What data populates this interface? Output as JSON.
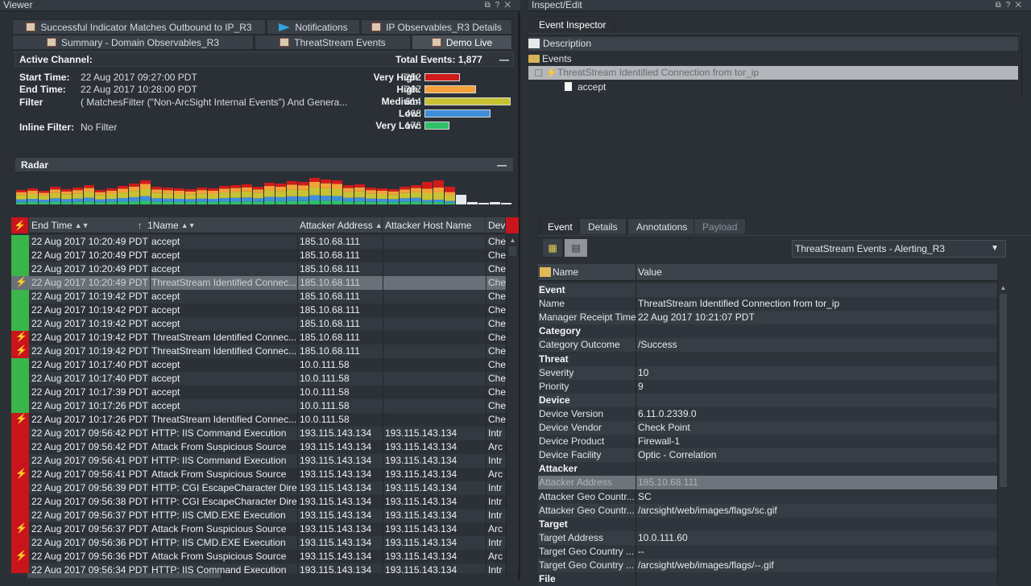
{
  "viewer": {
    "title": "Viewer",
    "tabs_row1": [
      "Successful Indicator Matches Outbound to IP_R3",
      "Notifications",
      "IP Observables_R3 Details"
    ],
    "tabs_row2": [
      "Summary - Domain Observables_R3",
      "ThreatStream Events",
      "Demo Live"
    ],
    "active_channel_label": "Active Channel:",
    "total_events_label": "Total Events: 1,877",
    "start_time_label": "Start Time:",
    "start_time": "22 Aug 2017 09:27:00 PDT",
    "end_time_label": "End Time:",
    "end_time": "22 Aug 2017 10:28:00 PDT",
    "filter_label": "Filter",
    "filter_value": "( MatchesFilter (\"Non-ArcSight Internal Events\") And Genera...",
    "inline_filter_label": "Inline Filter:",
    "inline_filter_value": "No Filter",
    "severity": [
      {
        "label": "Very High:",
        "count": "252",
        "value": 252,
        "color": "#d11a1a"
      },
      {
        "label": "High:",
        "count": "367",
        "value": 367,
        "color": "#f3a23a"
      },
      {
        "label": "Medium:",
        "count": "614",
        "value": 614,
        "color": "#c8c233"
      },
      {
        "label": "Low:",
        "count": "468",
        "value": 468,
        "color": "#3f8fd9"
      },
      {
        "label": "Very Low:",
        "count": "176",
        "value": 176,
        "color": "#2fbf6a"
      }
    ],
    "radar_label": "Radar",
    "minimize": "—",
    "columns": [
      "End Time",
      "1",
      "Name",
      "Attacker Address",
      "Attacker Host Name",
      "Dev"
    ],
    "rows": [
      {
        "ind": "green",
        "time": "22 Aug 2017 10:20:49 PDT",
        "name": "accept",
        "addr": "185.10.68.111",
        "host": "",
        "dev": "Che"
      },
      {
        "ind": "green",
        "time": "22 Aug 2017 10:20:49 PDT",
        "name": "accept",
        "addr": "185.10.68.111",
        "host": "",
        "dev": "Che"
      },
      {
        "ind": "green",
        "time": "22 Aug 2017 10:20:49 PDT",
        "name": "accept",
        "addr": "185.10.68.111",
        "host": "",
        "dev": "Che"
      },
      {
        "ind": "bolt",
        "time": "22 Aug 2017 10:20:49 PDT",
        "name": "ThreatStream Identified Connec...",
        "addr": "185.10.68.111",
        "host": "",
        "dev": "Che",
        "sel": true
      },
      {
        "ind": "green",
        "time": "22 Aug 2017 10:19:42 PDT",
        "name": "accept",
        "addr": "185.10.68.111",
        "host": "",
        "dev": "Che"
      },
      {
        "ind": "green",
        "time": "22 Aug 2017 10:19:42 PDT",
        "name": "accept",
        "addr": "185.10.68.111",
        "host": "",
        "dev": "Che"
      },
      {
        "ind": "green",
        "time": "22 Aug 2017 10:19:42 PDT",
        "name": "accept",
        "addr": "185.10.68.111",
        "host": "",
        "dev": "Che"
      },
      {
        "ind": "bolt",
        "time": "22 Aug 2017 10:19:42 PDT",
        "name": "ThreatStream Identified Connec...",
        "addr": "185.10.68.111",
        "host": "",
        "dev": "Che"
      },
      {
        "ind": "bolt",
        "time": "22 Aug 2017 10:19:42 PDT",
        "name": "ThreatStream Identified Connec...",
        "addr": "185.10.68.111",
        "host": "",
        "dev": "Che"
      },
      {
        "ind": "green",
        "time": "22 Aug 2017 10:17:40 PDT",
        "name": "accept",
        "addr": "10.0.111.58",
        "host": "",
        "dev": "Che"
      },
      {
        "ind": "green",
        "time": "22 Aug 2017 10:17:40 PDT",
        "name": "accept",
        "addr": "10.0.111.58",
        "host": "",
        "dev": "Che"
      },
      {
        "ind": "green",
        "time": "22 Aug 2017 10:17:39 PDT",
        "name": "accept",
        "addr": "10.0.111.58",
        "host": "",
        "dev": "Che"
      },
      {
        "ind": "green",
        "time": "22 Aug 2017 10:17:26 PDT",
        "name": "accept",
        "addr": "10.0.111.58",
        "host": "",
        "dev": "Che"
      },
      {
        "ind": "bolt",
        "time": "22 Aug 2017 10:17:26 PDT",
        "name": "ThreatStream Identified Connec...",
        "addr": "10.0.111.58",
        "host": "",
        "dev": "Che"
      },
      {
        "ind": "red",
        "time": "22 Aug 2017 09:56:42 PDT",
        "name": "HTTP: IIS Command Execution",
        "addr": "193.115.143.134",
        "host": "193.115.143.134",
        "dev": "Intr"
      },
      {
        "ind": "red",
        "time": "22 Aug 2017 09:56:42 PDT",
        "name": "Attack From Suspicious Source",
        "addr": "193.115.143.134",
        "host": "193.115.143.134",
        "dev": "Arc"
      },
      {
        "ind": "red",
        "time": "22 Aug 2017 09:56:41 PDT",
        "name": "HTTP: IIS Command Execution",
        "addr": "193.115.143.134",
        "host": "193.115.143.134",
        "dev": "Intr"
      },
      {
        "ind": "bolt",
        "time": "22 Aug 2017 09:56:41 PDT",
        "name": "Attack From Suspicious Source",
        "addr": "193.115.143.134",
        "host": "193.115.143.134",
        "dev": "Arc"
      },
      {
        "ind": "red",
        "time": "22 Aug 2017 09:56:39 PDT",
        "name": "HTTP: CGI EscapeCharacter Dire...",
        "addr": "193.115.143.134",
        "host": "193.115.143.134",
        "dev": "Intr"
      },
      {
        "ind": "red",
        "time": "22 Aug 2017 09:56:38 PDT",
        "name": "HTTP: CGI EscapeCharacter Dire...",
        "addr": "193.115.143.134",
        "host": "193.115.143.134",
        "dev": "Intr"
      },
      {
        "ind": "red",
        "time": "22 Aug 2017 09:56:37 PDT",
        "name": "HTTP: IIS CMD.EXE Execution",
        "addr": "193.115.143.134",
        "host": "193.115.143.134",
        "dev": "Intr"
      },
      {
        "ind": "bolt",
        "time": "22 Aug 2017 09:56:37 PDT",
        "name": "Attack From Suspicious Source",
        "addr": "193.115.143.134",
        "host": "193.115.143.134",
        "dev": "Arc"
      },
      {
        "ind": "red",
        "time": "22 Aug 2017 09:56:36 PDT",
        "name": "HTTP: IIS CMD.EXE Execution",
        "addr": "193.115.143.134",
        "host": "193.115.143.134",
        "dev": "Intr"
      },
      {
        "ind": "bolt",
        "time": "22 Aug 2017 09:56:36 PDT",
        "name": "Attack From Suspicious Source",
        "addr": "193.115.143.134",
        "host": "193.115.143.134",
        "dev": "Arc"
      },
      {
        "ind": "red",
        "time": "22 Aug 2017 09:56:34 PDT",
        "name": "HTTP: IIS Command Execution",
        "addr": "193.115.143.134",
        "host": "193.115.143.134",
        "dev": "Intr"
      }
    ]
  },
  "inspect": {
    "title": "Inspect/Edit",
    "tab": "Event Inspector",
    "tree_description": "Description",
    "tree_events": "Events",
    "tree_selected": "ThreatStream Identified Connection from tor_ip",
    "tree_child": "accept",
    "lower_tabs": [
      "Event",
      "Details",
      "Annotations",
      "Payload"
    ],
    "dropdown_value": "ThreatStream Events - Alerting_R3",
    "col_name": "Name",
    "col_value": "Value",
    "fields": [
      {
        "k": "Event",
        "v": "",
        "group": true
      },
      {
        "k": "Name",
        "v": "ThreatStream Identified Connection from tor_ip"
      },
      {
        "k": "Manager Receipt Time",
        "v": "22 Aug 2017 10:21:07 PDT"
      },
      {
        "k": "Category",
        "v": "",
        "group": true
      },
      {
        "k": "Category Outcome",
        "v": "/Success"
      },
      {
        "k": "Threat",
        "v": "",
        "group": true
      },
      {
        "k": "Severity",
        "v": "10"
      },
      {
        "k": "Priority",
        "v": "9"
      },
      {
        "k": "Device",
        "v": "",
        "group": true
      },
      {
        "k": "Device Version",
        "v": "6.11.0.2339.0"
      },
      {
        "k": "Device Vendor",
        "v": "Check Point"
      },
      {
        "k": "Device Product",
        "v": "Firewall-1"
      },
      {
        "k": "Device Facility",
        "v": "Optic - Correlation"
      },
      {
        "k": "Attacker",
        "v": "",
        "group": true
      },
      {
        "k": "Attacker Address",
        "v": "185.10.68.111",
        "sel": true
      },
      {
        "k": "Attacker Geo Countr...",
        "v": "SC"
      },
      {
        "k": "Attacker Geo Countr...",
        "v": "/arcsight/web/images/flags/sc.gif"
      },
      {
        "k": "Target",
        "v": "",
        "group": true
      },
      {
        "k": "Target Address",
        "v": "10.0.111.60"
      },
      {
        "k": "Target Geo Country ...",
        "v": "--"
      },
      {
        "k": "Target Geo Country ...",
        "v": "/arcsight/web/images/flags/--.gif"
      },
      {
        "k": "File",
        "v": "",
        "group": true
      }
    ]
  }
}
